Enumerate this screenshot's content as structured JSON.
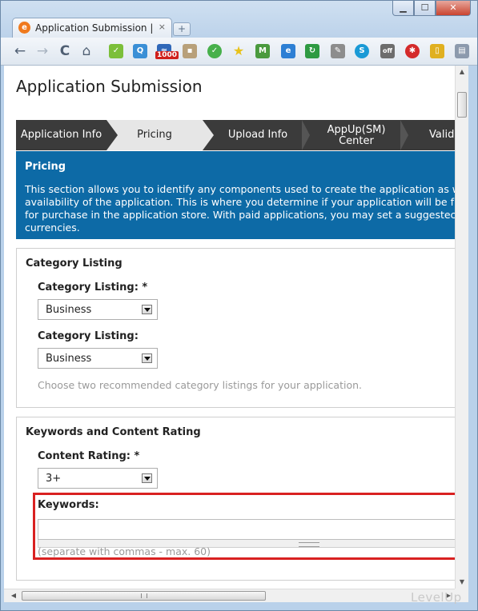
{
  "browser": {
    "tab_title": "Application Submission | ...",
    "tab_close": "×",
    "new_tab": "+",
    "window_controls": {
      "minimize": "▁",
      "maximize": "☐",
      "close": "✕"
    },
    "nav": {
      "back": "←",
      "forward": "→",
      "reload": "C",
      "home": "⌂"
    },
    "badge": "1000",
    "extension_off_label": "off"
  },
  "page": {
    "title": "Application Submission",
    "steps": [
      {
        "label": "Application Info",
        "active": false
      },
      {
        "label": "Pricing",
        "active": true
      },
      {
        "label": "Upload Info",
        "active": false
      },
      {
        "label": "AppUp(SM)",
        "label2": "Center",
        "active": false
      },
      {
        "label": "Valida",
        "active": false
      }
    ],
    "info": {
      "title": "Pricing",
      "lines": [
        "This section allows you to identify any components used to create the application as w",
        "availability of the application. This is where you determine if your application will be fr",
        "for purchase in the application store. With paid applications, you may set a suggestec",
        "currencies."
      ]
    },
    "category_panel": {
      "title": "Category Listing",
      "field1_label": "Category Listing: *",
      "field1_value": "Business",
      "field2_label": "Category Listing:",
      "field2_value": "Business",
      "hint": "Choose two recommended category listings for your application."
    },
    "keywords_panel": {
      "title": "Keywords and Content Rating",
      "rating_label": "Content Rating: *",
      "rating_value": "3+",
      "keywords_label": "Keywords:",
      "keywords_value": "",
      "keywords_hint": "(separate with commas - max. 60)"
    }
  },
  "watermark": "LevelUp",
  "colors": {
    "info_bg": "#0d6aa6",
    "steps_bg": "#3b3b3b",
    "highlight": "#d92121"
  }
}
